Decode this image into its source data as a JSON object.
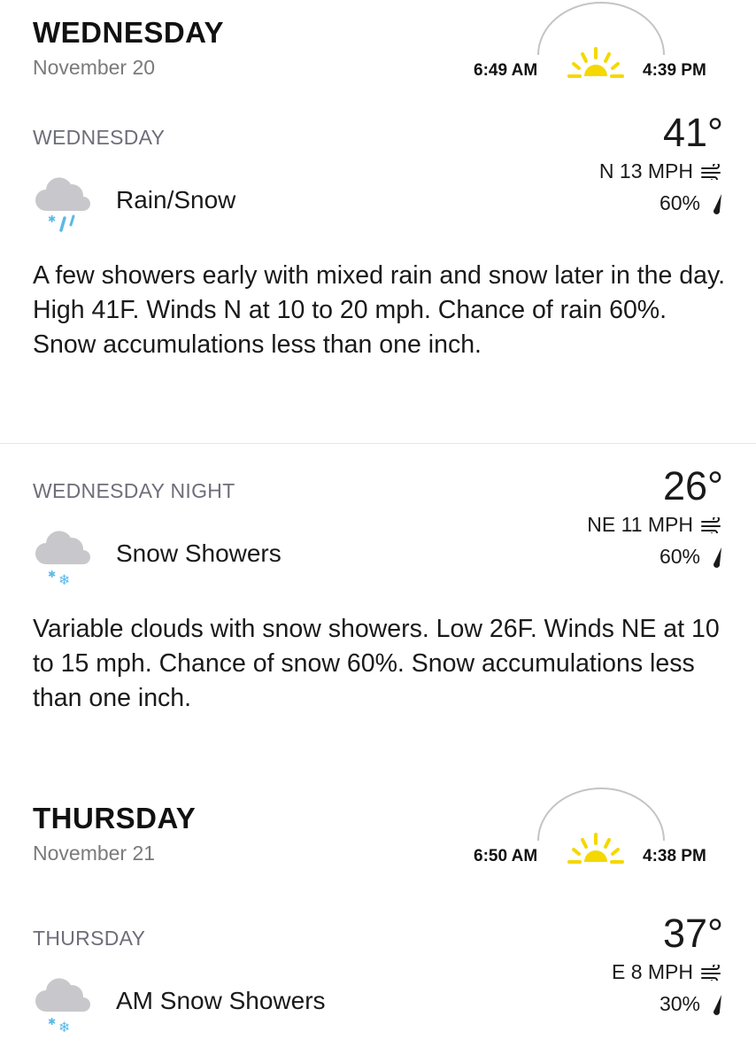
{
  "days": [
    {
      "title": "WEDNESDAY",
      "date": "November 20",
      "sunrise": "6:49 AM",
      "sunset": "4:39 PM"
    },
    {
      "title": "THURSDAY",
      "date": "November 21",
      "sunrise": "6:50 AM",
      "sunset": "4:38 PM"
    }
  ],
  "periods": [
    {
      "name": "WEDNESDAY",
      "temp": "41°",
      "wind": "N 13 MPH",
      "precip": "60%",
      "condition": "Rain/Snow",
      "condition_icon": "rain-snow-icon",
      "narrative": "A few showers early with mixed rain and snow later in the day. High 41F. Winds N at 10 to 20 mph. Chance of rain 60%. Snow accumulations less than one inch."
    },
    {
      "name": "WEDNESDAY NIGHT",
      "temp": "26°",
      "wind": "NE 11 MPH",
      "precip": "60%",
      "condition": "Snow Showers",
      "condition_icon": "snow-showers-icon",
      "narrative": "Variable clouds with snow showers. Low 26F. Winds NE at 10 to 15 mph. Chance of snow 60%. Snow accumulations less than one inch."
    },
    {
      "name": "THURSDAY",
      "temp": "37°",
      "wind": "E 8 MPH",
      "precip": "30%",
      "condition": "AM Snow Showers",
      "condition_icon": "snow-showers-icon"
    }
  ],
  "colors": {
    "sun": "#f5d800",
    "cloud": "#c8c8cc",
    "rain": "#5bb8e8",
    "snow": "#5bb8e8",
    "period_label": "#6e6e7a",
    "date": "#7a7a7a"
  }
}
